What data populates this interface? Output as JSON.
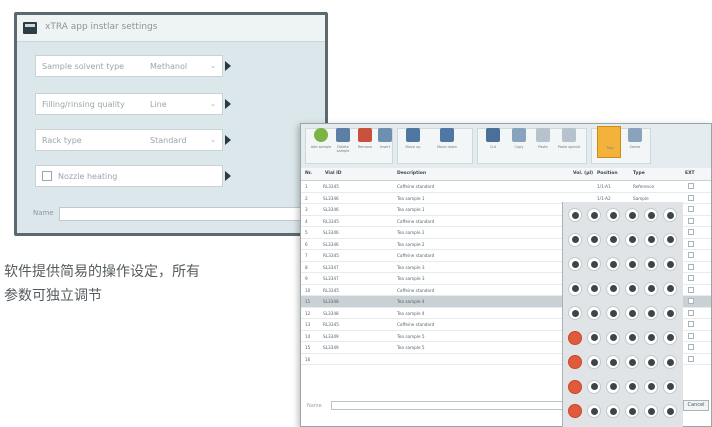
{
  "settings_window": {
    "title": "xTRA app instlar settings",
    "rows": [
      {
        "label": "Sample solvent type",
        "value": "Methanol"
      },
      {
        "label": "Filling/rinsing quality",
        "value": "Line"
      },
      {
        "label": "Rack type",
        "value": "Standard"
      }
    ],
    "nozzle_label": "Nozzle heating",
    "name_label": "Name",
    "name_value": ""
  },
  "caption": {
    "line1": "软件提供简易的操作设定，所有",
    "line2": "参数可独立调节"
  },
  "sample_window": {
    "ribbon": [
      {
        "label": "Add sample",
        "icon": "add-icon",
        "color": "#7bb445"
      },
      {
        "label": "Delete sample",
        "icon": "delete-icon",
        "color": "#5d7fa6"
      },
      {
        "label": "Remove",
        "icon": "remove-icon",
        "color": "#c8503c"
      },
      {
        "label": "Insert",
        "icon": "insert-icon",
        "color": "#6f8fb0"
      },
      {
        "label": "Move up",
        "icon": "move-up-icon",
        "color": "#4f77a3"
      },
      {
        "label": "Move down",
        "icon": "move-down-icon",
        "color": "#4f77a3"
      },
      {
        "label": "Cut",
        "icon": "cut-icon",
        "color": "#4a6f98"
      },
      {
        "label": "Copy",
        "icon": "copy-icon",
        "color": "#8aa3bd"
      },
      {
        "label": "Paste",
        "icon": "paste-icon",
        "color": "#b7c3cc"
      },
      {
        "label": "Paste special",
        "icon": "paste-special-icon",
        "color": "#b7c3cc"
      },
      {
        "label": "Tray",
        "icon": "tray-icon",
        "color": "#f3b33a"
      },
      {
        "label": "Series",
        "icon": "series-icon",
        "color": "#8aa3bd"
      }
    ],
    "columns": [
      "Nr.",
      "Vial ID",
      "Description",
      "Vol. (µl)",
      "Position",
      "Type",
      "EXT"
    ],
    "rows": [
      {
        "nr": "1",
        "vial": "RL3345",
        "desc": "Caffeine standard",
        "pos": "1/1-A1",
        "type": "Reference"
      },
      {
        "nr": "2",
        "vial": "SL3346",
        "desc": "Tea sample 1",
        "pos": "1/1-A2",
        "type": "Sample"
      },
      {
        "nr": "3",
        "vial": "SL3346",
        "desc": "Tea sample 1",
        "pos": "",
        "type": ""
      },
      {
        "nr": "4",
        "vial": "RL3345",
        "desc": "Caffeine standard",
        "pos": "",
        "type": ""
      },
      {
        "nr": "5",
        "vial": "SL3346",
        "desc": "Tea sample 2",
        "pos": "",
        "type": ""
      },
      {
        "nr": "6",
        "vial": "SL3346",
        "desc": "Tea sample 2",
        "pos": "",
        "type": ""
      },
      {
        "nr": "7",
        "vial": "RL3345",
        "desc": "Caffeine standard",
        "pos": "",
        "type": ""
      },
      {
        "nr": "8",
        "vial": "SL3347",
        "desc": "Tea sample 3",
        "pos": "",
        "type": ""
      },
      {
        "nr": "9",
        "vial": "SL3347",
        "desc": "Tea sample 3",
        "pos": "",
        "type": ""
      },
      {
        "nr": "10",
        "vial": "RL3345",
        "desc": "Caffeine standard",
        "pos": "",
        "type": ""
      },
      {
        "nr": "11",
        "vial": "SL3348",
        "desc": "Tea sample 4",
        "pos": "",
        "type": ""
      },
      {
        "nr": "12",
        "vial": "SL3348",
        "desc": "Tea sample 4",
        "pos": "",
        "type": ""
      },
      {
        "nr": "13",
        "vial": "RL3345",
        "desc": "Caffeine standard",
        "pos": "",
        "type": ""
      },
      {
        "nr": "14",
        "vial": "SL3349",
        "desc": "Tea sample 5",
        "pos": "",
        "type": ""
      },
      {
        "nr": "15",
        "vial": "SL3349",
        "desc": "Tea sample 5",
        "pos": "",
        "type": ""
      },
      {
        "nr": "16",
        "vial": "",
        "desc": "",
        "pos": "",
        "type": ""
      }
    ],
    "selected_row": 11,
    "footer_label": "Name",
    "cancel_label": "Cancel"
  },
  "tray": {
    "rows": 9,
    "cols": 6,
    "occupied_wells": [
      [
        5,
        0
      ],
      [
        6,
        0
      ],
      [
        7,
        0
      ],
      [
        8,
        0
      ]
    ]
  },
  "colors": {
    "accent": "#f3b33a",
    "occupied_well": "#e25a3c",
    "window_frame": "#5c6a70"
  }
}
